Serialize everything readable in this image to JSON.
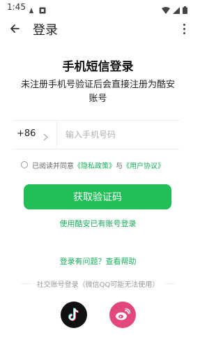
{
  "status_bar": {
    "time": "1:45"
  },
  "app_bar": {
    "title": "登录"
  },
  "main": {
    "heading": "手机短信登录",
    "subheading": "未注册手机号验证后会直接注册为酷安账号",
    "country_code": "+86",
    "phone_placeholder": "输入手机号码",
    "phone_value": ""
  },
  "agreement": {
    "prefix": "已阅读并同意",
    "privacy_link": "《隐私政策》",
    "conjunction": "与",
    "user_agreement_link": "《用户协议》",
    "checked": false
  },
  "actions": {
    "get_code_label": "获取验证码",
    "alt_login_label": "使用酷安已有账号登录",
    "help_label": "登录有问题？查看帮助"
  },
  "social": {
    "label": "社交账号登录（微信QQ可能无法使用）",
    "buttons": [
      "tiktok-icon",
      "weibo-icon"
    ]
  },
  "colors": {
    "accent": "#21bf56",
    "link": "#16b05a",
    "tiktok_bg": "#111111",
    "weibo_bg": "#e2477d"
  }
}
